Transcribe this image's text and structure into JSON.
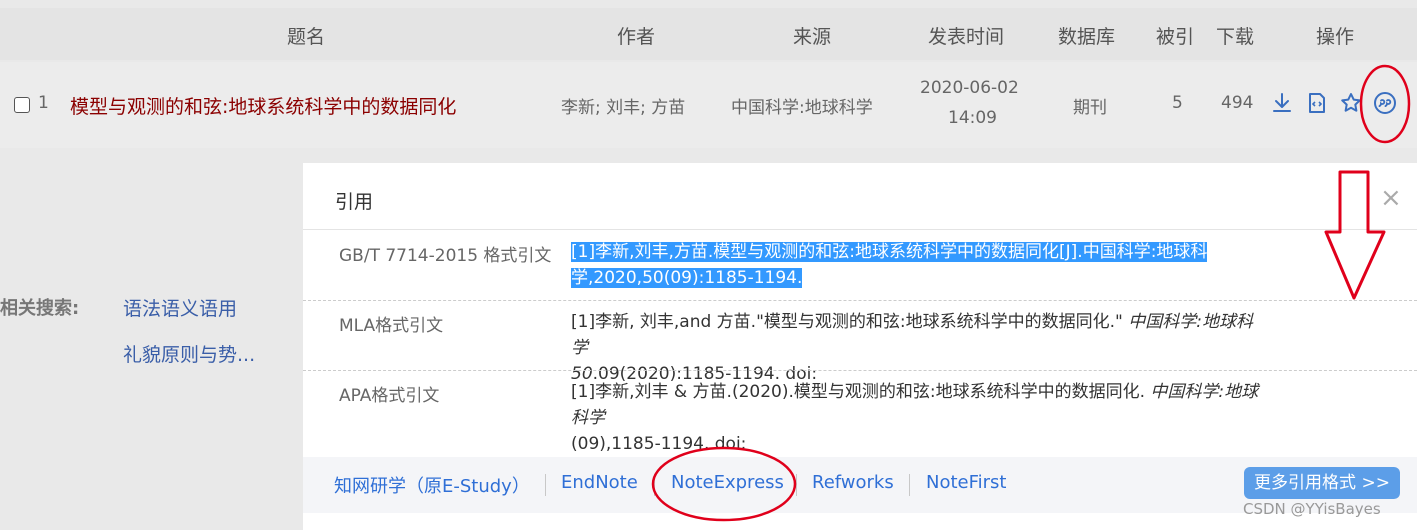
{
  "table": {
    "headers": {
      "title": "题名",
      "author": "作者",
      "source": "来源",
      "date": "发表时间",
      "database": "数据库",
      "cited": "被引",
      "downloads": "下载",
      "actions": "操作"
    },
    "row": {
      "index": "1",
      "title": "模型与观测的和弦:地球系统科学中的数据同化",
      "authors": "李新; 刘丰; 方苗",
      "source": "中国科学:地球科学",
      "date": "2020-06-02",
      "time": "14:09",
      "database": "期刊",
      "cited": "5",
      "downloads": "494",
      "action_icons": [
        "download-icon",
        "html-read-icon",
        "favorite-icon",
        "cite-icon"
      ]
    }
  },
  "related": {
    "label": "相关搜索:",
    "links": [
      "语法语义语用",
      "礼貌原则与势..."
    ]
  },
  "dialog": {
    "title": "引用",
    "close": "×",
    "citations": [
      {
        "label": "GB/T 7714-2015 格式引文",
        "line1": "[1]李新,刘丰,方苗.模型与观测的和弦:地球系统科学中的数据同化[J].中国科学:地球科",
        "line2": "学,2020,50(09):1185-1194."
      },
      {
        "label": "MLA格式引文",
        "line1_plain": "[1]李新, 刘丰,and 方苗.\"模型与观测的和弦:地球系统科学中的数据同化.\" ",
        "line1_italic": "中国科学:地球科学",
        "line2_italic": "50",
        "line2_plain": ".09(2020):1185-1194. doi:"
      },
      {
        "label": "APA格式引文",
        "line1_plain": "[1]李新,刘丰 & 方苗.(2020).模型与观测的和弦:地球系统科学中的数据同化. ",
        "line1_italic": "中国科学:地球科学",
        "line2_plain": "(09),1185-1194. doi:"
      }
    ],
    "export_links": [
      "知网研学（原E-Study）",
      "EndNote",
      "NoteExpress",
      "Refworks",
      "NoteFirst"
    ],
    "more_button": "更多引用格式 >>"
  },
  "watermark": "CSDN @YYisBayes",
  "colors": {
    "title_red": "#8b0000",
    "link_blue": "#2f6fd6",
    "highlight_blue": "#3399ff",
    "annotation_red": "#e0001b",
    "button_blue": "#5c9ee8"
  }
}
